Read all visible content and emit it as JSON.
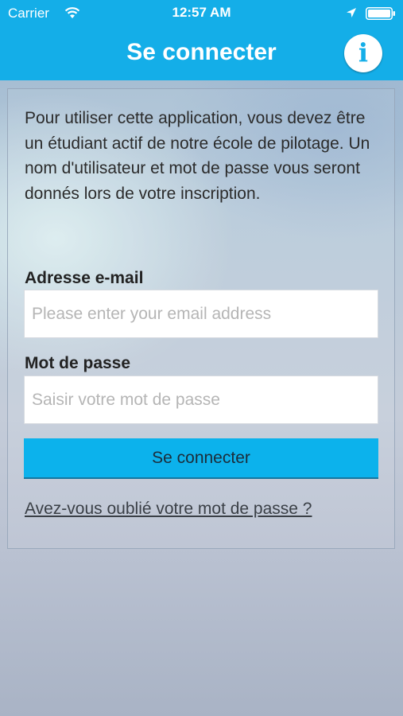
{
  "status_bar": {
    "carrier": "Carrier",
    "time": "12:57 AM",
    "icons": [
      "wifi-icon",
      "location-icon",
      "battery-icon"
    ]
  },
  "nav": {
    "title": "Se connecter",
    "info_icon": "i"
  },
  "login": {
    "intro": "Pour utiliser cette application, vous devez être un étudiant actif de notre école de pilotage. Un nom d'utilisateur et mot de passe vous seront donnés lors de votre inscription.",
    "email_label": "Adresse e-mail",
    "email_value": "",
    "email_placeholder": "Please enter your email address",
    "password_label": "Mot de passe",
    "password_value": "",
    "password_placeholder": "Saisir votre mot de passe",
    "submit_label": "Se connecter",
    "forgot_link": "Avez-vous oublié votre mot de passe ?"
  },
  "colors": {
    "accent": "#14aee8",
    "button": "#0cb2ec",
    "text": "#2b2b2b"
  }
}
